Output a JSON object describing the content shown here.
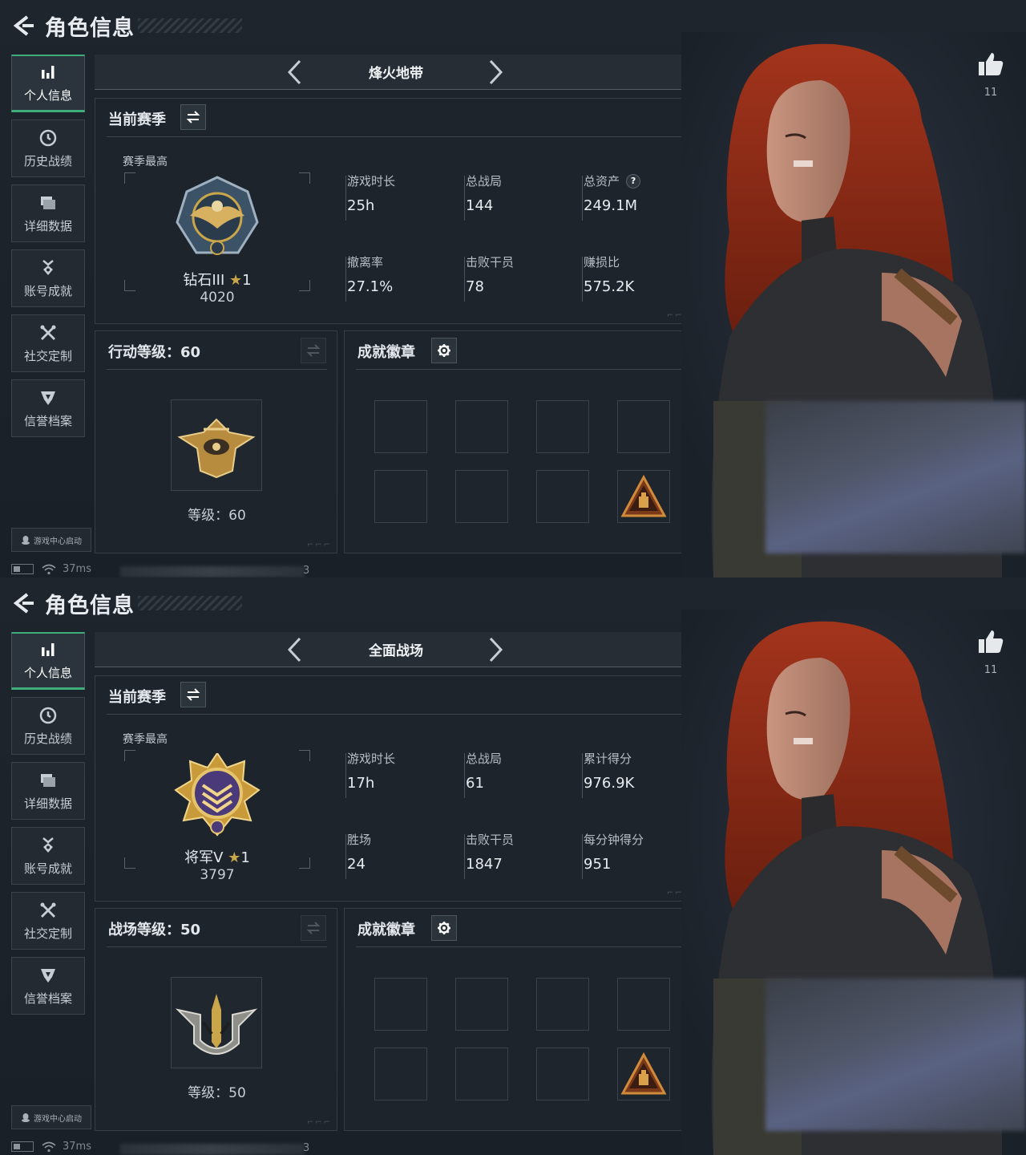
{
  "screens": [
    {
      "header": {
        "title": "角色信息"
      },
      "sidebar": {
        "items": [
          {
            "label": "个人信息",
            "icon": "bar-chart-icon",
            "active": true
          },
          {
            "label": "历史战绩",
            "icon": "clock-icon",
            "active": false
          },
          {
            "label": "详细数据",
            "icon": "folder-icon",
            "active": false
          },
          {
            "label": "账号成就",
            "icon": "medal-icon",
            "active": false
          },
          {
            "label": "社交定制",
            "icon": "tools-icon",
            "active": false
          },
          {
            "label": "信誉档案",
            "icon": "shield-icon",
            "active": false
          }
        ]
      },
      "game_center": "游戏中心启动",
      "status": {
        "ping": "37ms",
        "trailing": "3"
      },
      "mode": {
        "name": "烽火地带"
      },
      "season": {
        "title": "当前赛季",
        "high_label": "赛季最高",
        "rank_name": "钻石III",
        "rank_star": "★",
        "rank_stars_count": "1",
        "rank_score": "4020",
        "stats": [
          {
            "key": "游戏时长",
            "value": "25h",
            "help": false
          },
          {
            "key": "总战局",
            "value": "144",
            "help": false
          },
          {
            "key": "总资产",
            "value": "249.1M",
            "help": true
          },
          {
            "key": "撤离率",
            "value": "27.1%",
            "help": false
          },
          {
            "key": "击败干员",
            "value": "78",
            "help": false
          },
          {
            "key": "赚损比",
            "value": "575.2K",
            "help": false
          }
        ],
        "help_mark": "?"
      },
      "level": {
        "title": "行动等级：60",
        "label": "等级：60"
      },
      "achievement": {
        "title": "成就徽章"
      },
      "likes": {
        "count": "11"
      }
    },
    {
      "header": {
        "title": "角色信息"
      },
      "sidebar": {
        "items": [
          {
            "label": "个人信息",
            "icon": "bar-chart-icon",
            "active": true
          },
          {
            "label": "历史战绩",
            "icon": "clock-icon",
            "active": false
          },
          {
            "label": "详细数据",
            "icon": "folder-icon",
            "active": false
          },
          {
            "label": "账号成就",
            "icon": "medal-icon",
            "active": false
          },
          {
            "label": "社交定制",
            "icon": "tools-icon",
            "active": false
          },
          {
            "label": "信誉档案",
            "icon": "shield-icon",
            "active": false
          }
        ]
      },
      "game_center": "游戏中心启动",
      "status": {
        "ping": "37ms",
        "trailing": "3"
      },
      "mode": {
        "name": "全面战场"
      },
      "season": {
        "title": "当前赛季",
        "high_label": "赛季最高",
        "rank_name": "将军V",
        "rank_star": "★",
        "rank_stars_count": "1",
        "rank_score": "3797",
        "stats": [
          {
            "key": "游戏时长",
            "value": "17h",
            "help": false
          },
          {
            "key": "总战局",
            "value": "61",
            "help": false
          },
          {
            "key": "累计得分",
            "value": "976.9K",
            "help": false
          },
          {
            "key": "胜场",
            "value": "24",
            "help": false
          },
          {
            "key": "击败干员",
            "value": "1847",
            "help": false
          },
          {
            "key": "每分钟得分",
            "value": "951",
            "help": false
          }
        ],
        "help_mark": "?"
      },
      "level": {
        "title": "战场等级：50",
        "label": "等级：50"
      },
      "achievement": {
        "title": "成就徽章"
      },
      "likes": {
        "count": "11"
      }
    }
  ],
  "colors": {
    "accent": "#3fae7a",
    "gold": "#c9a64a",
    "panel_bg": "#1e252c",
    "hair": "#8c2a17"
  }
}
